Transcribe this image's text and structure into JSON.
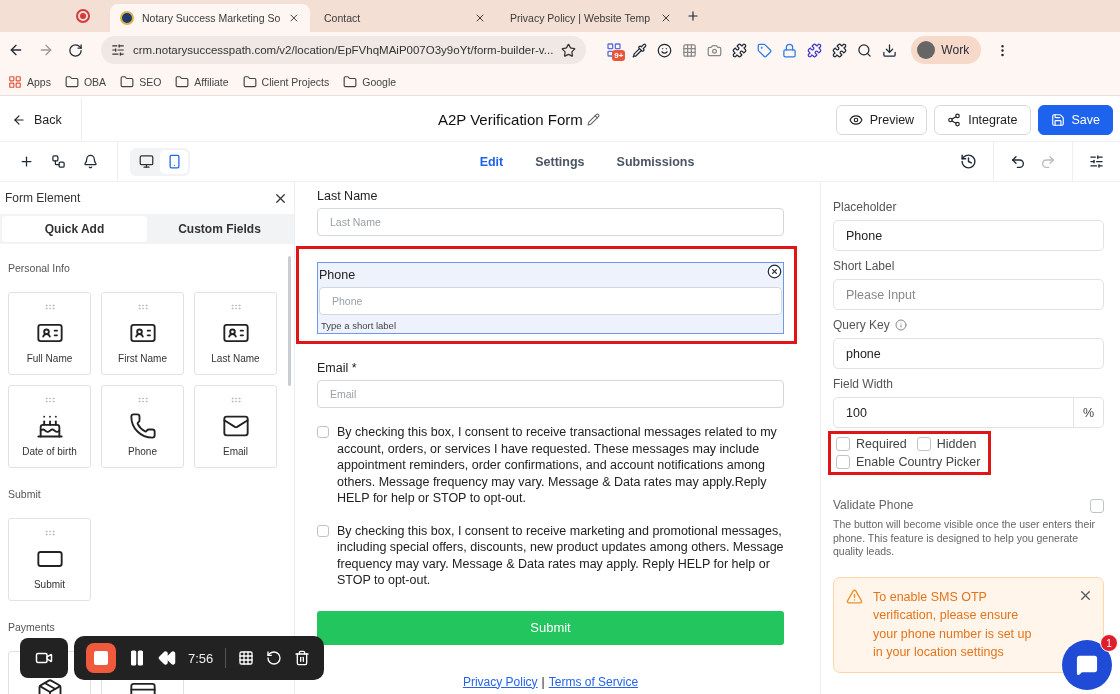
{
  "browser": {
    "tabs": [
      {
        "title": "Notary Success Marketing So",
        "selected": true
      },
      {
        "title": "Contact",
        "selected": false
      },
      {
        "title": "Privacy Policy | Website Temp",
        "selected": false
      }
    ],
    "url": "crm.notarysuccesspath.com/v2/location/EpFVhqMAiP007O3y9oYt/form-builder-v...",
    "extension_badge": "9+",
    "profile": "Work",
    "bookmarks": [
      {
        "label": "Apps",
        "kind": "apps"
      },
      {
        "label": "OBA",
        "kind": "folder"
      },
      {
        "label": "SEO",
        "kind": "folder"
      },
      {
        "label": "Affiliate",
        "kind": "folder"
      },
      {
        "label": "Client Projects",
        "kind": "folder"
      },
      {
        "label": "Google",
        "kind": "folder"
      }
    ]
  },
  "header": {
    "back": "Back",
    "title": "A2P Verification Form",
    "buttons": [
      {
        "label": "Preview",
        "kind": "preview"
      },
      {
        "label": "Integrate",
        "kind": "integrate"
      },
      {
        "label": "Save",
        "kind": "save"
      }
    ]
  },
  "toolbar": {
    "devices": [
      {
        "kind": "desktop",
        "selected": false
      },
      {
        "kind": "mobile",
        "selected": true
      }
    ],
    "tabs": [
      {
        "label": "Edit",
        "selected": true
      },
      {
        "label": "Settings",
        "selected": false
      },
      {
        "label": "Submissions",
        "selected": false
      }
    ]
  },
  "left_panel": {
    "title": "Form Element",
    "tabs": [
      {
        "label": "Quick Add",
        "selected": true
      },
      {
        "label": "Custom Fields",
        "selected": false
      }
    ],
    "sections": [
      {
        "title": "Personal Info",
        "items": [
          {
            "label": "Full Name",
            "kind": "name"
          },
          {
            "label": "First Name",
            "kind": "name"
          },
          {
            "label": "Last Name",
            "kind": "name"
          },
          {
            "label": "Date of birth",
            "kind": "dob"
          },
          {
            "label": "Phone",
            "kind": "phone"
          },
          {
            "label": "Email",
            "kind": "email"
          }
        ]
      },
      {
        "title": "Submit",
        "items": [
          {
            "label": "Submit",
            "kind": "button"
          }
        ]
      },
      {
        "title": "Payments",
        "items": [
          {
            "kind": "product"
          },
          {
            "kind": "payment"
          }
        ]
      }
    ]
  },
  "form": {
    "fields": [
      {
        "label": "Last Name",
        "placeholder": "Last Name",
        "selected": false,
        "highlighted": false
      },
      {
        "label": "Phone",
        "placeholder": "Phone",
        "short_label": "Type a short label",
        "selected": true,
        "highlighted": true
      },
      {
        "label": "Email *",
        "placeholder": "Email",
        "selected": false,
        "highlighted": false
      }
    ],
    "consents": [
      {
        "text": "By checking this box, I consent to receive transactional messages related to my account, orders, or services I have requested. These messages may include appointment reminders, order confirmations, and account notifications among others. Message frequency may vary. Message & Data rates may apply.Reply HELP for help or STOP to opt-out.",
        "checked": false
      },
      {
        "text": "By checking this box, I consent to receive marketing and promotional messages, including special offers, discounts, new product updates among others. Message frequency may vary. Message & Data rates may apply. Reply HELP for help or STOP to opt-out.",
        "checked": false
      }
    ],
    "submit": "Submit",
    "links": [
      "Privacy Policy",
      "Terms of Service"
    ],
    "link_separator": "|"
  },
  "settings": {
    "fields": [
      {
        "label": "Placeholder",
        "value": "Phone"
      },
      {
        "label": "Short Label",
        "placeholder": "Please Input"
      },
      {
        "label": "Query Key",
        "value": "phone",
        "info": true
      },
      {
        "label": "Field Width",
        "value": "100",
        "suffix": "%"
      }
    ],
    "options": [
      {
        "label": "Required",
        "checked": false
      },
      {
        "label": "Hidden",
        "checked": false
      },
      {
        "label": "Enable Country Picker",
        "checked": false
      }
    ],
    "options_highlighted": true,
    "validate": {
      "label": "Validate Phone",
      "checked": false,
      "description": "The button will become visible once the user enters their phone. This feature is designed to help you generate quality leads."
    },
    "alert": "To enable SMS OTP verification, please ensure your phone number is set up in your location settings"
  },
  "recorder": {
    "time": "7:56"
  },
  "chat": {
    "badge": "1"
  }
}
